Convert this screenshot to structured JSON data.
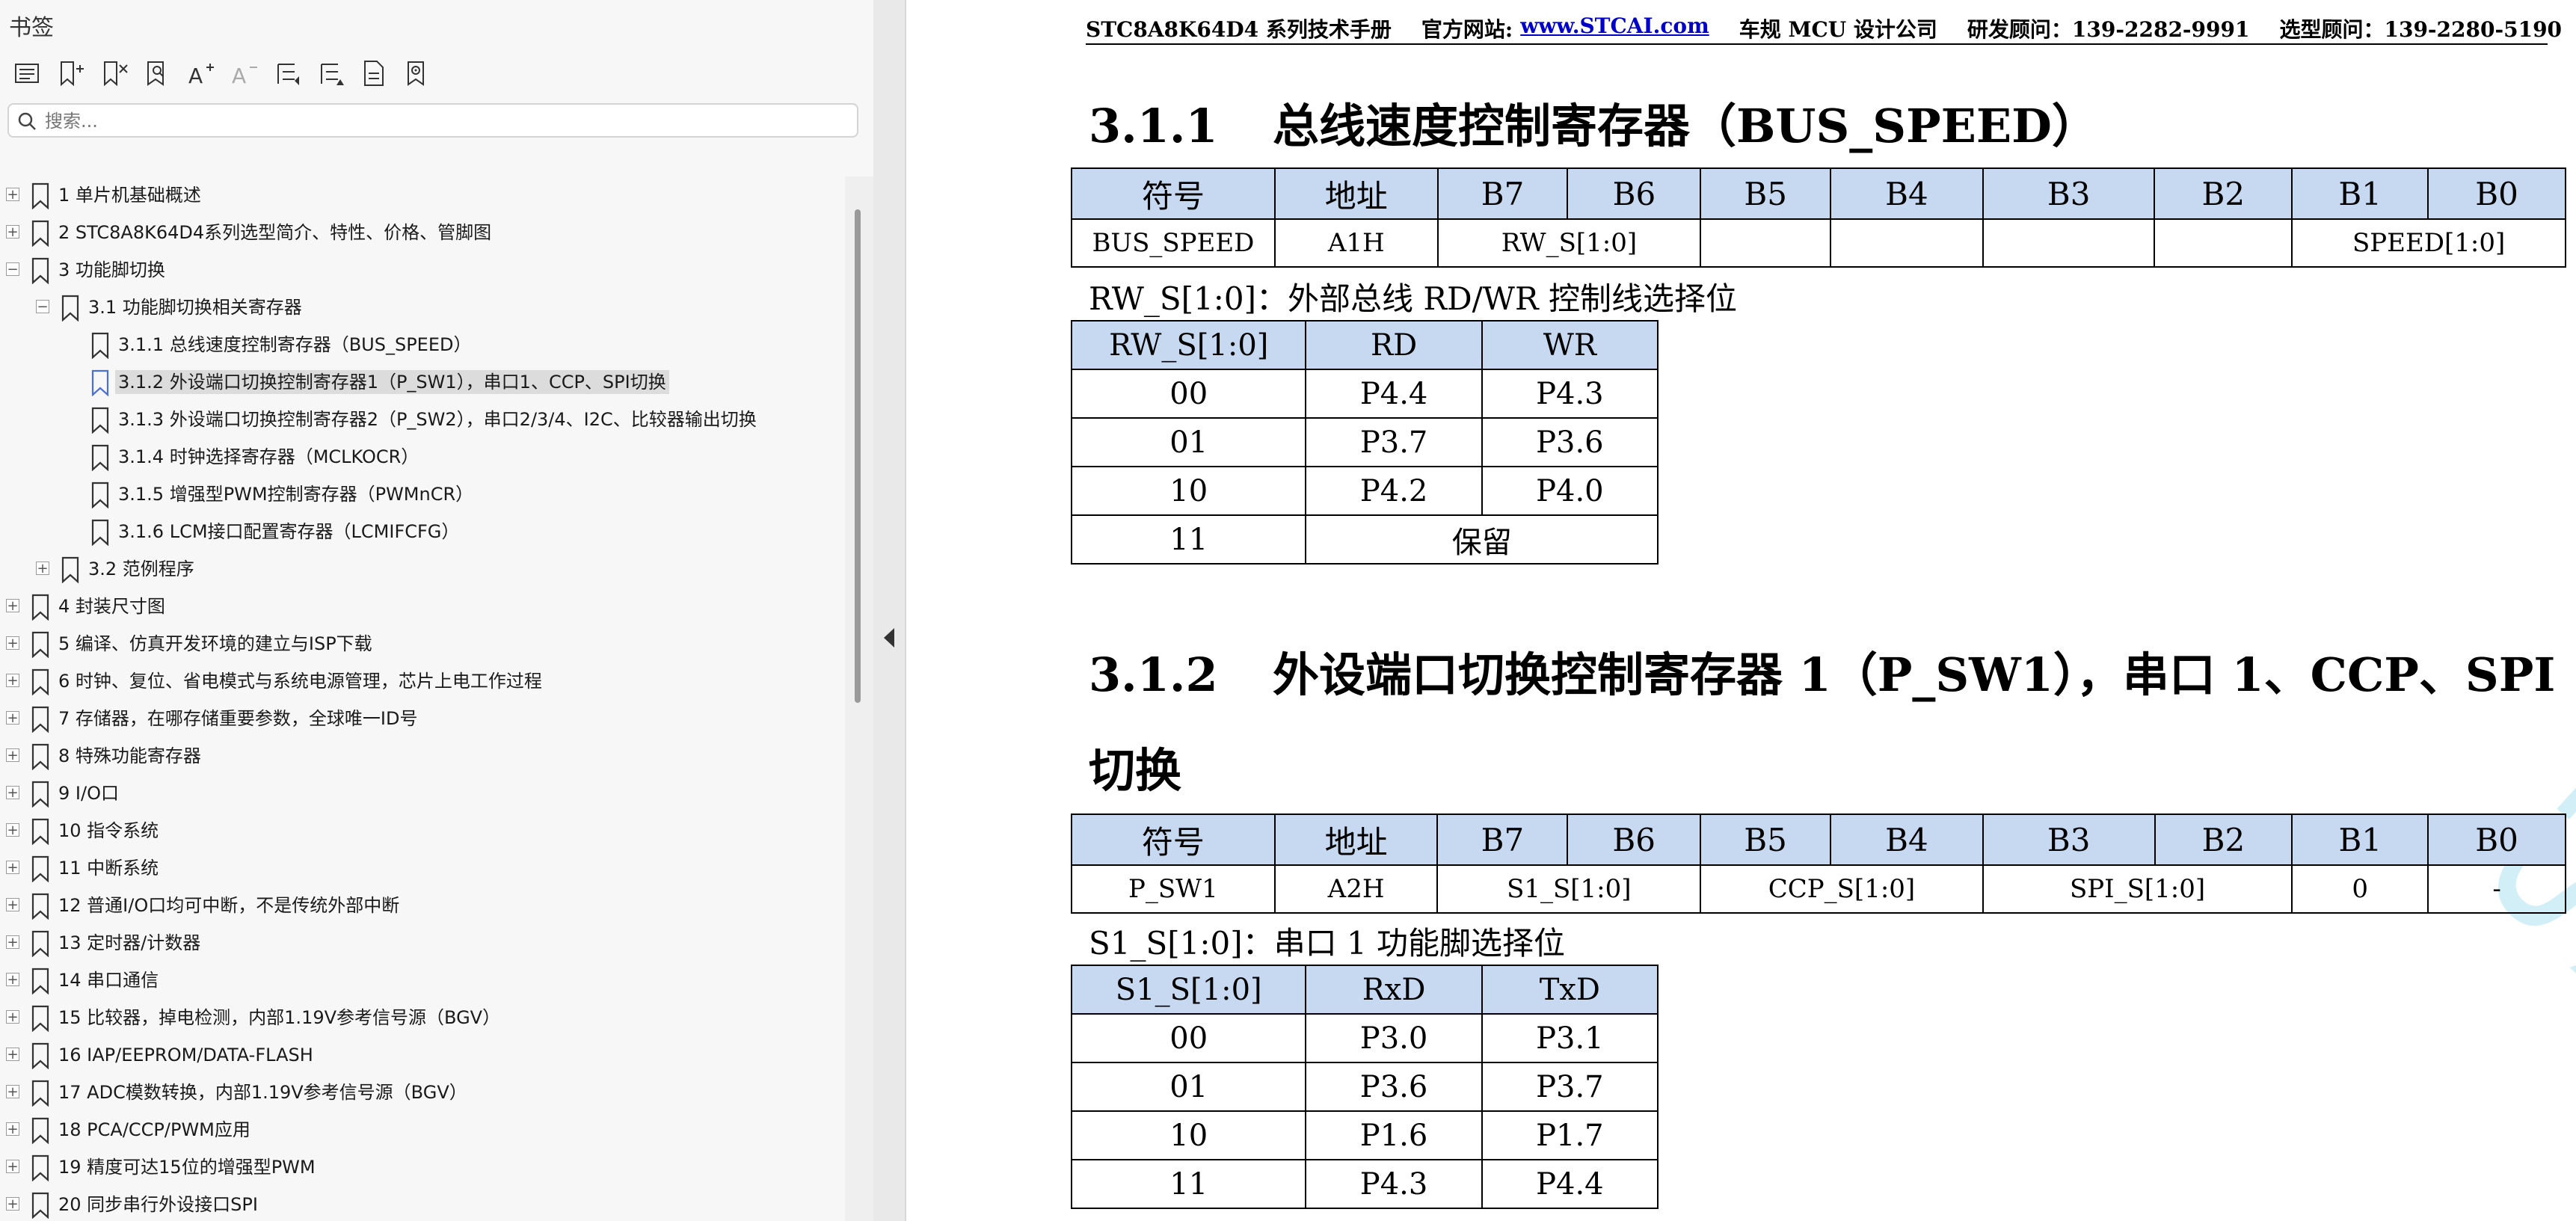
{
  "sidebar": {
    "title": "书签",
    "search_placeholder": "搜索...",
    "toolbar": [
      {
        "icon": "bookmark-list-icon"
      },
      {
        "icon": "bookmark-add-icon"
      },
      {
        "icon": "bookmark-delete-icon"
      },
      {
        "icon": "bookmark-find-icon"
      },
      {
        "icon": "font-increase-icon"
      },
      {
        "icon": "font-decrease-icon"
      },
      {
        "icon": "expand-all-icon"
      },
      {
        "icon": "collapse-all-icon"
      },
      {
        "icon": "bookmark-properties-icon"
      },
      {
        "icon": "bookmark-locate-icon"
      }
    ],
    "items": [
      {
        "label": "1 单片机基础概述",
        "level": 0,
        "exp": "+",
        "sel": false
      },
      {
        "label": "2  STC8A8K64D4系列选型简介、特性、价格、管脚图",
        "level": 0,
        "exp": "+",
        "sel": false
      },
      {
        "label": "3  功能脚切换",
        "level": 0,
        "exp": "−",
        "sel": false
      },
      {
        "label": "3.1 功能脚切换相关寄存器",
        "level": 1,
        "exp": "−",
        "sel": false
      },
      {
        "label": "3.1.1  总线速度控制寄存器（BUS_SPEED）",
        "level": 2,
        "exp": "",
        "sel": false
      },
      {
        "label": "3.1.2 外设端口切换控制寄存器1（P_SW1），串口1、CCP、SPI切换",
        "level": 2,
        "exp": "",
        "sel": true
      },
      {
        "label": "3.1.3  外设端口切换控制寄存器2（P_SW2），串口2/3/4、I2C、比较器输出切换",
        "level": 2,
        "exp": "",
        "sel": false
      },
      {
        "label": "3.1.4 时钟选择寄存器（MCLKOCR）",
        "level": 2,
        "exp": "",
        "sel": false
      },
      {
        "label": "3.1.5  增强型PWM控制寄存器（PWMnCR）",
        "level": 2,
        "exp": "",
        "sel": false
      },
      {
        "label": "3.1.6 LCM接口配置寄存器（LCMIFCFG）",
        "level": 2,
        "exp": "",
        "sel": false
      },
      {
        "label": "3.2  范例程序",
        "level": 1,
        "exp": "+",
        "sel": false
      },
      {
        "label": "4  封装尺寸图",
        "level": 0,
        "exp": "+",
        "sel": false
      },
      {
        "label": "5  编译、仿真开发环境的建立与ISP下载",
        "level": 0,
        "exp": "+",
        "sel": false
      },
      {
        "label": "6  时钟、复位、省电模式与系统电源管理，芯片上电工作过程",
        "level": 0,
        "exp": "+",
        "sel": false
      },
      {
        "label": "7  存储器，在哪存储重要参数，全球唯一ID号",
        "level": 0,
        "exp": "+",
        "sel": false
      },
      {
        "label": "8  特殊功能寄存器",
        "level": 0,
        "exp": "+",
        "sel": false
      },
      {
        "label": "9  I/O口",
        "level": 0,
        "exp": "+",
        "sel": false
      },
      {
        "label": "10  指令系统",
        "level": 0,
        "exp": "+",
        "sel": false
      },
      {
        "label": "11  中断系统",
        "level": 0,
        "exp": "+",
        "sel": false
      },
      {
        "label": "12  普通I/O口均可中断，不是传统外部中断",
        "level": 0,
        "exp": "+",
        "sel": false
      },
      {
        "label": "13  定时器/计数器",
        "level": 0,
        "exp": "+",
        "sel": false
      },
      {
        "label": "14  串口通信",
        "level": 0,
        "exp": "+",
        "sel": false
      },
      {
        "label": "15  比较器，掉电检测，内部1.19V参考信号源（BGV）",
        "level": 0,
        "exp": "+",
        "sel": false
      },
      {
        "label": "16  IAP/EEPROM/DATA-FLASH",
        "level": 0,
        "exp": "+",
        "sel": false
      },
      {
        "label": "17  ADC模数转换，内部1.19V参考信号源（BGV）",
        "level": 0,
        "exp": "+",
        "sel": false
      },
      {
        "label": "18  PCA/CCP/PWM应用",
        "level": 0,
        "exp": "+",
        "sel": false
      },
      {
        "label": "19  精度可达15位的增强型PWM",
        "level": 0,
        "exp": "+",
        "sel": false
      },
      {
        "label": "20 同步串行外设接口SPI",
        "level": 0,
        "exp": "+",
        "sel": false
      }
    ]
  },
  "doc": {
    "header": {
      "manual": "STC8A8K64D4 系列技术手册",
      "site_label": "官方网站:",
      "site_url": "www.STCAI.com",
      "company": "车规 MCU 设计公司",
      "rd_contact": "研发顾问：139-2282-9991",
      "sales_contact": "选型顾问：139-2280-5190"
    },
    "sec1": {
      "num": "3.1.1",
      "title": "总线速度控制寄存器（BUS_SPEED）",
      "reg_header": [
        "符号",
        "地址",
        "B7",
        "B6",
        "B5",
        "B4",
        "B3",
        "B2",
        "B1",
        "B0"
      ],
      "reg_values": {
        "symbol": "BUS_SPEED",
        "addr": "A1H",
        "rw": "RW_S[1:0]",
        "speed": "SPEED[1:0]"
      },
      "note": "RW_S[1:0]：外部总线 RD/WR 控制线选择位",
      "sel_header": [
        "RW_S[1:0]",
        "RD",
        "WR"
      ],
      "sel_rows": [
        [
          "00",
          "P4.4",
          "P4.3"
        ],
        [
          "01",
          "P3.7",
          "P3.6"
        ],
        [
          "10",
          "P4.2",
          "P4.0"
        ]
      ],
      "sel_reserved": {
        "code": "11",
        "text": "保留"
      }
    },
    "sec2": {
      "num": "3.1.2",
      "title": "外设端口切换控制寄存器 1（P_SW1），串口 1、CCP、SPI",
      "title_cont": "切换",
      "reg_header": [
        "符号",
        "地址",
        "B7",
        "B6",
        "B5",
        "B4",
        "B3",
        "B2",
        "B1",
        "B0"
      ],
      "reg_values": {
        "symbol": "P_SW1",
        "addr": "A2H",
        "s1": "S1_S[1:0]",
        "ccp": "CCP_S[1:0]",
        "spi": "SPI_S[1:0]",
        "b1": "0",
        "b0": "-"
      },
      "note": "S1_S[1:0]：串口 1 功能脚选择位",
      "sel_header": [
        "S1_S[1:0]",
        "RxD",
        "TxD"
      ],
      "sel_rows": [
        [
          "00",
          "P3.0",
          "P3.1"
        ],
        [
          "01",
          "P3.6",
          "P3.7"
        ],
        [
          "10",
          "P1.6",
          "P1.7"
        ],
        [
          "11",
          "P4.3",
          "P4.4"
        ]
      ]
    },
    "watermark": "STC MCU"
  }
}
